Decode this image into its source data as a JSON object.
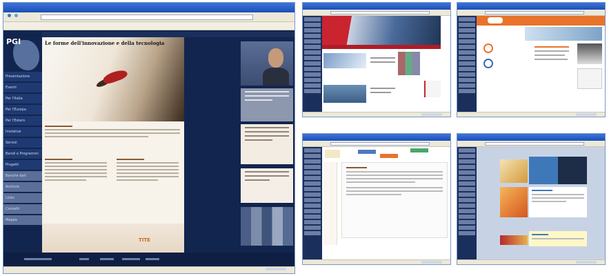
{
  "main": {
    "logo": "PGI",
    "headline": "Le forme dell'innovazione e della tecnologia",
    "promo": "TITE",
    "nav_items": [
      "Presentazione",
      "Eventi",
      "Per l'Italia",
      "Per l'Europa",
      "Per l'Estero",
      "Iniziative",
      "Servizi",
      "Bandi e Programmi",
      "Progetti",
      "Banche dati",
      "Archivio",
      "Links",
      "Contatti",
      "Mappa"
    ]
  },
  "thumbnails": [
    {
      "name": "thumb-1"
    },
    {
      "name": "thumb-2"
    },
    {
      "name": "thumb-3"
    },
    {
      "name": "thumb-4"
    }
  ],
  "colors": {
    "window_title": "#1b4fb8",
    "site_navy": "#12254e",
    "accent_orange": "#e8732a"
  }
}
